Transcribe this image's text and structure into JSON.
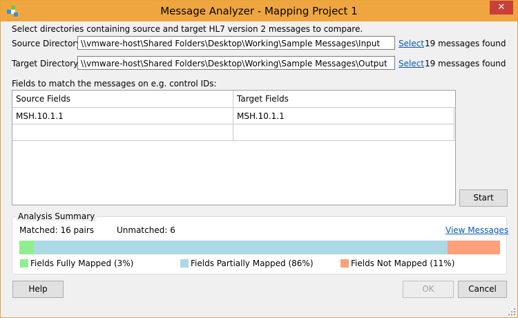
{
  "window": {
    "title": "Message Analyzer - Mapping Project 1",
    "close_glyph": "✕"
  },
  "instructions": "Select directories containing source and target HL7 version 2 messages to compare.",
  "source": {
    "label": "Source Directory:",
    "path": "\\\\vmware-host\\Shared Folders\\Desktop\\Working\\Sample Messages\\Input",
    "select_label": "Select",
    "count_text": "19 messages found"
  },
  "target": {
    "label": "Target Directory:",
    "path": "\\\\vmware-host\\Shared Folders\\Desktop\\Working\\Sample Messages\\Output",
    "select_label": "Select",
    "count_text": "19 messages found"
  },
  "fields": {
    "caption": "Fields to match the messages on e.g. control IDs:",
    "columns": [
      "Source Fields",
      "Target Fields"
    ],
    "rows": [
      [
        "MSH.10.1.1",
        "MSH.10.1.1"
      ],
      [
        "",
        ""
      ]
    ]
  },
  "start_label": "Start",
  "summary": {
    "label": "Analysis Summary",
    "matched_text": "Matched: 16 pairs",
    "unmatched_text": "Unmatched: 6",
    "view_link": "View Messages",
    "segments": [
      {
        "name": "Fields Fully Mapped (3%)",
        "percent": 3,
        "color": "#90ee90"
      },
      {
        "name": "Fields Partially Mapped (86%)",
        "percent": 86,
        "color": "#add8e6"
      },
      {
        "name": "Fields Not Mapped (11%)",
        "percent": 11,
        "color": "#ffa07a"
      }
    ]
  },
  "buttons": {
    "help": "Help",
    "ok": "OK",
    "cancel": "Cancel"
  }
}
